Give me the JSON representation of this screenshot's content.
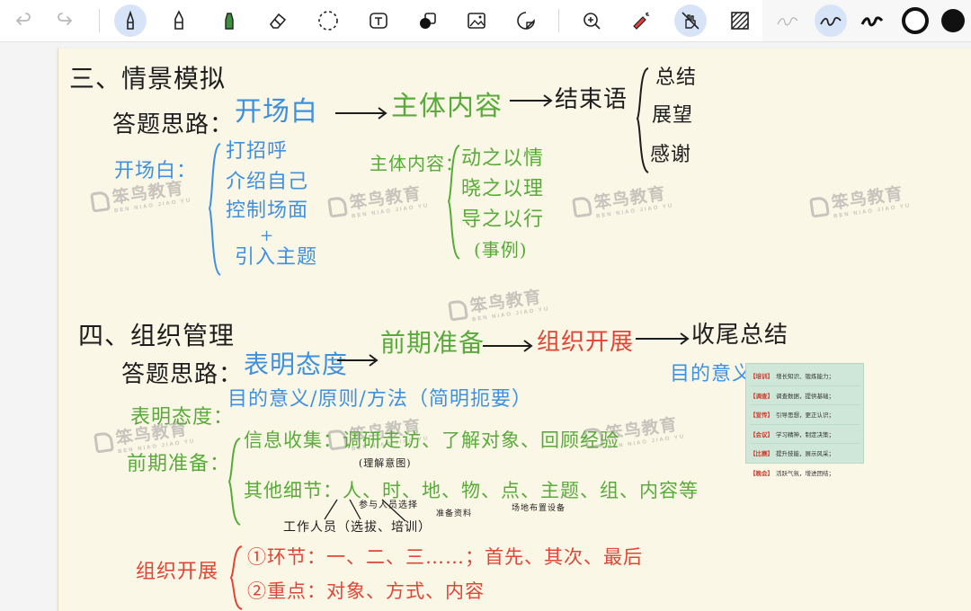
{
  "toolbar": {
    "tools": [
      {
        "name": "undo-icon"
      },
      {
        "name": "redo-icon"
      },
      {
        "name": "fountain-pen-icon",
        "active": true
      },
      {
        "name": "pencil-icon"
      },
      {
        "name": "highlighter-icon"
      },
      {
        "name": "eraser-icon"
      },
      {
        "name": "lasso-icon"
      },
      {
        "name": "text-icon"
      },
      {
        "name": "shape-icon"
      },
      {
        "name": "image-icon"
      },
      {
        "name": "sticker-icon"
      },
      {
        "name": "zoom-icon"
      },
      {
        "name": "laser-pointer-icon"
      },
      {
        "name": "hand-draw-icon",
        "active": true
      },
      {
        "name": "background-pattern-icon"
      }
    ],
    "pen_styles": [
      "thin",
      "medium",
      "thick"
    ],
    "pen_selected": "medium",
    "colors": [
      "#111111",
      "#111111"
    ],
    "accent": "#d7e4f8"
  },
  "note": {
    "s3": {
      "title": "三、情景模拟",
      "label": "答题思路：",
      "step1": "开场白",
      "step2": "主体内容",
      "step3": "结束语",
      "end_items": [
        "总结",
        "展望",
        "感谢"
      ],
      "open_label": "开场白：",
      "open_items": [
        "打招呼",
        "介绍自己",
        "控制场面",
        "+",
        "引入主题"
      ],
      "body_label": "主体内容：",
      "body_items": [
        "动之以情",
        "晓之以理",
        "导之以行",
        "(事例)"
      ]
    },
    "s4": {
      "title": "四、组织管理",
      "label": "答题思路：",
      "step1": "表明态度",
      "step2": "前期准备",
      "step3": "组织开展",
      "step4": "收尾总结",
      "purpose_label": "目的意义：",
      "attitude_label": "表明态度：",
      "attitude_text": "目的意义/原则/方法（简明扼要）",
      "prep_label": "前期准备：",
      "prep_line1": "信息收集：调研走访、了解对象、回顾经验",
      "prep_line2": "其他细节：人、时、地、物、点、主题、组、内容等",
      "note_arrow": "(理解意图)",
      "note_staff": "工作人员（选拔、培训）",
      "note_participants": "参与人员选择",
      "note_materials": "准备资料",
      "note_equipment": "场地布置设备",
      "run_label": "组织开展",
      "run_line1": "①环节：一、二、三……；首先、其次、最后",
      "run_line2": "②重点：对象、方式、内容"
    },
    "purpose_table": [
      {
        "key": "【培训】",
        "text": "增长知识、锻炼能力；"
      },
      {
        "key": "【调查】",
        "text": "调查数据，提供基础；"
      },
      {
        "key": "【宣传】",
        "text": "引导思想，更正认识；"
      },
      {
        "key": "【会议】",
        "text": "学习精神，制定决策；"
      },
      {
        "key": "【比赛】",
        "text": "提升技能，展示风采；"
      },
      {
        "key": "【晚会】",
        "text": "活跃气氛，增进团结；"
      }
    ]
  },
  "watermark": {
    "name": "笨鸟教育",
    "en": "BEN NIAO JIAO YU"
  }
}
